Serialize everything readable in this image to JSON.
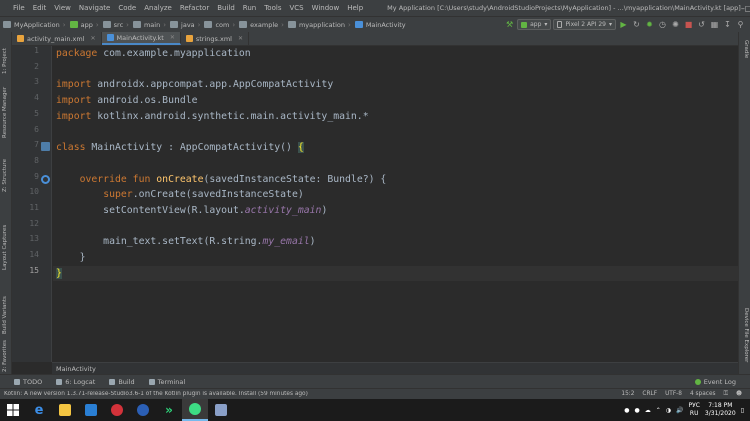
{
  "menubar": {
    "items": [
      "File",
      "Edit",
      "View",
      "Navigate",
      "Code",
      "Analyze",
      "Refactor",
      "Build",
      "Run",
      "Tools",
      "VCS",
      "Window",
      "Help"
    ],
    "window_title": "My Application [C:\\Users\\study\\AndroidStudioProjects\\MyApplication] - ...\\myapplication\\MainActivity.kt [app]"
  },
  "navbar": {
    "crumbs": [
      "MyApplication",
      "app",
      "src",
      "main",
      "java",
      "com",
      "example",
      "myapplication",
      "MainActivity"
    ],
    "run_config": "app",
    "device": "Pixel 2 API 29"
  },
  "tabs": [
    {
      "label": "activity_main.xml",
      "active": false
    },
    {
      "label": "MainActivity.kt",
      "active": true
    },
    {
      "label": "strings.xml",
      "active": false
    }
  ],
  "left_tools": [
    "1: Project",
    "Resource Manager",
    "Z: Structure",
    "Layout Captures",
    "Build Variants",
    "2: Favorites"
  ],
  "right_tools": [
    "Gradle",
    "Device File Explorer"
  ],
  "editor": {
    "line_numbers": [
      "1",
      "2",
      "3",
      "4",
      "5",
      "6",
      "7",
      "8",
      "9",
      "10",
      "11",
      "12",
      "13",
      "14",
      "15"
    ],
    "lines": {
      "l1_kw": "package",
      "l1_rest": " com.example.myapplication",
      "l3_kw": "import",
      "l3_rest": " androidx.appcompat.app.AppCompatActivity",
      "l4_kw": "import",
      "l4_rest": " android.os.Bundle",
      "l5_kw": "import",
      "l5_rest": " kotlinx.android.synthetic.main.activity_main.*",
      "l7_kw": "class",
      "l7_rest": " MainActivity : AppCompatActivity() ",
      "l7_brace": "{",
      "l9_indent": "    ",
      "l9_kw": "override fun",
      "l9_sp": " ",
      "l9_fn": "onCreate",
      "l9_rest": "(savedInstanceState: Bundle?) {",
      "l10_indent": "        ",
      "l10_kw": "super",
      "l10_rest": ".onCreate(savedInstanceState)",
      "l11_pre": "        setContentView(R.layout.",
      "l11_ref": "activity_main",
      "l11_post": ")",
      "l13_pre": "        main_text.setText(R.string.",
      "l13_ref": "my_email",
      "l13_post": ")",
      "l14_text": "    }",
      "l15_brace": "}"
    }
  },
  "breadcrumb": "MainActivity",
  "toolwindows": {
    "todo": "TODO",
    "logcat": "6: Logcat",
    "build": "Build",
    "terminal": "Terminal",
    "event_log": "Event Log"
  },
  "status": {
    "message": "Kotlin: A new version 1.3.71-release-Studio3.6-1 of the Kotlin plugin is available. Install (59 minutes ago)",
    "position": "15:2",
    "line_sep": "CRLF",
    "encoding": "UTF-8",
    "indent": "4 spaces"
  },
  "taskbar": {
    "lang": "РУС",
    "lang2": "RU",
    "time": "7:18 PM",
    "date": "3/31/2020"
  },
  "colors": {
    "keyword": "#cc7832",
    "function": "#ffc66d",
    "field": "#9876aa",
    "text": "#a9b7c6",
    "background": "#2b2b2b"
  }
}
